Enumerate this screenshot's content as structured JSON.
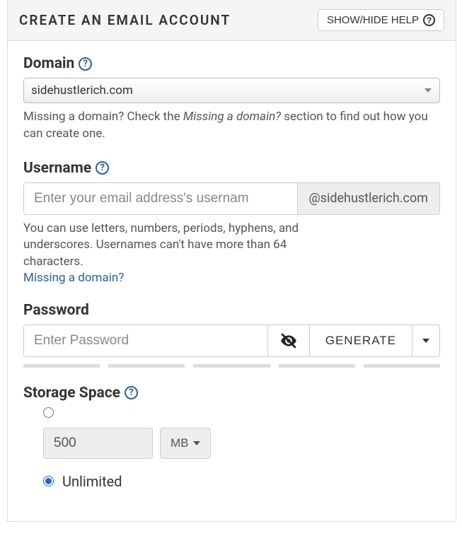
{
  "header": {
    "title": "Create an Email Account",
    "help_button": "SHOW/HIDE HELP"
  },
  "domain": {
    "label": "Domain",
    "selected": "sidehustlerich.com",
    "hint_pre": "Missing a domain? Check the ",
    "hint_italic": "Missing a domain?",
    "hint_post": " section to find out how you can create one."
  },
  "username": {
    "label": "Username",
    "placeholder": "Enter your email address's usernam",
    "suffix": "@sidehustlerich.com",
    "hint": "You can use letters, numbers, periods, hyphens, and underscores. Usernames can't have more than 64 characters.",
    "missing_link": "Missing a domain?"
  },
  "password": {
    "label": "Password",
    "placeholder": "Enter Password",
    "generate": "GENERATE"
  },
  "storage": {
    "label": "Storage Space",
    "fixed_value": "500",
    "unit": "MB",
    "unlimited_label": "Unlimited",
    "selected": "unlimited"
  }
}
